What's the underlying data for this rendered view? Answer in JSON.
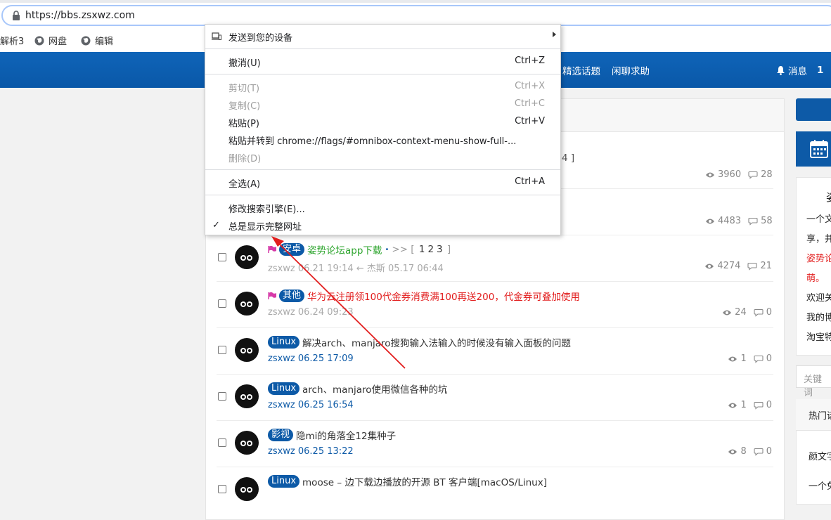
{
  "browser": {
    "url": "https://bbs.zsxwz.com",
    "bookmarks": [
      {
        "label": "解析3"
      },
      {
        "label": "网盘"
      },
      {
        "label": "编辑"
      }
    ]
  },
  "site": {
    "nav": [
      {
        "label": "精选话题"
      },
      {
        "label": "闲聊求助"
      }
    ],
    "notify_label": "消息",
    "notify_count": "1"
  },
  "context_menu": {
    "send_to_device": "发送到您的设备",
    "undo": {
      "label": "撤消(U)",
      "shortcut": "Ctrl+Z"
    },
    "cut": {
      "label": "剪切(T)",
      "shortcut": "Ctrl+X"
    },
    "copy": {
      "label": "复制(C)",
      "shortcut": "Ctrl+C"
    },
    "paste": {
      "label": "粘贴(P)",
      "shortcut": "Ctrl+V"
    },
    "paste_go": {
      "label": "粘贴并转到 chrome://flags/#omnibox-context-menu-show-full-..."
    },
    "delete": {
      "label": "删除(D)"
    },
    "select_all": {
      "label": "全选(A)",
      "shortcut": "Ctrl+A"
    },
    "edit_search": {
      "label": "修改搜索引擎(E)..."
    },
    "show_full_url": {
      "label": "总是显示完整网址",
      "checked": true
    }
  },
  "partial_rows": [
    {
      "page": "4 ]",
      "views": "3960",
      "replies": "28"
    },
    {
      "views": "4483",
      "replies": "58"
    }
  ],
  "threads": [
    {
      "tag": "安卓",
      "title": "姿势论坛app下载",
      "title_color": "green",
      "sticky": true,
      "dot": "•",
      "page_arrow": ">>",
      "pages": [
        "1",
        "2",
        "3"
      ],
      "bracket_open": "[",
      "bracket_close": "]",
      "meta": "zsxwz  06.21 19:14  ←  杰斯  05.17 06:44",
      "views": "4274",
      "replies": "21"
    },
    {
      "tag": "其他",
      "title": "华为云注册领100代金券消费满100再送200，代金券可叠加使用",
      "title_color": "red",
      "sticky": true,
      "meta": "zsxwz  06.24 09:23",
      "views": "24",
      "replies": "0"
    },
    {
      "tag": "Linux",
      "title": "解决arch、manjaro搜狗输入法输入的时候没有输入面板的问题",
      "meta": "zsxwz  06.25 17:09",
      "views": "1",
      "replies": "0"
    },
    {
      "tag": "Linux",
      "title": "arch、manjaro使用微信各种的坑",
      "meta": "zsxwz  06.25 16:54",
      "views": "1",
      "replies": "0"
    },
    {
      "tag": "影视",
      "title": "隐mi的角落全12集种子",
      "meta": "zsxwz  06.25 13:22",
      "views": "8",
      "replies": "0"
    },
    {
      "tag": "Linux",
      "title": "moose – 边下载边播放的开源 BT 客户端[macOS/Linux]",
      "meta": "",
      "views": "",
      "replies": ""
    }
  ],
  "right": {
    "lines": [
      {
        "text": "姿",
        "color": "#333"
      },
      {
        "text": "一个文",
        "color": "#333"
      },
      {
        "text": "享，并",
        "color": "#333"
      },
      {
        "text": "姿势论",
        "color": "#e21d1d"
      },
      {
        "text": "萌。",
        "color": "#e21d1d"
      },
      {
        "text": "欢迎关",
        "color": "#333"
      },
      {
        "text": "我的博",
        "color": "#333"
      },
      {
        "text": "淘宝特",
        "color": "#333"
      }
    ],
    "search_placeholder": "关键词",
    "hot_title": "热门话",
    "hot_items": [
      {
        "text": "颜文字"
      },
      {
        "text": "一个免"
      }
    ]
  },
  "colors": {
    "brand": "#0d5aa7",
    "annotation": "#e21d1d"
  }
}
